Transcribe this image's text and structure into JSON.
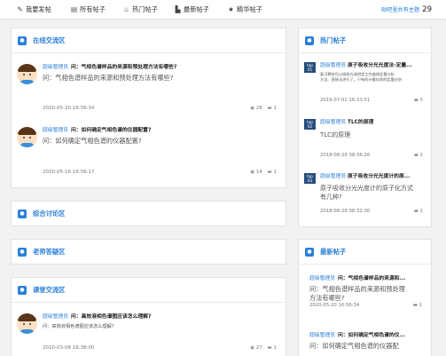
{
  "nav": {
    "items": [
      {
        "icon": "✎",
        "icon_name": "pencil-icon",
        "label": "我要发帖"
      },
      {
        "icon": "▤",
        "icon_name": "list-icon",
        "label": "所有帖子"
      },
      {
        "icon": "♨",
        "icon_name": "flame-icon",
        "label": "热门帖子"
      },
      {
        "icon": "▙",
        "icon_name": "bar-chart-icon",
        "label": "最新帖子"
      },
      {
        "icon": "★",
        "icon_name": "star-icon",
        "label": "精华帖子"
      }
    ],
    "total_label": "贴吧里共有主题",
    "total_count": "29"
  },
  "sections": {
    "online": {
      "title": "在线交流区",
      "posts": [
        {
          "author": "超级管理员",
          "title": "问：气相色谱样品的来源和预处理方法有哪些?",
          "body": "问：气相色谱样品的来源和预处理方法有哪些?",
          "date": "2020-05-20 16:56:34",
          "views": "28",
          "replies": "1"
        },
        {
          "author": "超级管理员",
          "title": "问：如何确定气相色谱的仪器配置?",
          "body": "问：如何确定气相色谱的仪器配置?",
          "date": "2020-05-16 16:56:17",
          "views": "14",
          "replies": "1"
        }
      ]
    },
    "general": {
      "title": "综合讨论区"
    },
    "teacher": {
      "title": "老师答疑区"
    },
    "class": {
      "title": "课堂交流区",
      "posts": [
        {
          "author": "超级管理员",
          "title": "问：高效液相色谱图应该怎么理解?",
          "body": "问：高效液相色谱图应该怎么理解?",
          "date": "2020-03-08 16:38:00",
          "views": "27",
          "replies": "1"
        }
      ]
    }
  },
  "hot": {
    "title": "热门帖子",
    "items": [
      {
        "rank": "01",
        "author": "超级管理员",
        "title": "原子吸收分光光度法-定量...",
        "body_lines": [
          "复习教材可以吸收光谱测定工作曲线定量分析",
          "方法、直接法进行了，只有的计量仪质的定量分析"
        ],
        "date": "2019-07-01 16:33:51",
        "replies": "5"
      },
      {
        "rank": "02",
        "author": "超级管理员",
        "title": "TLC的原理",
        "body_lines": [
          "TLC的原理"
        ],
        "date": "2018-08-28 08:36:26",
        "replies": "1"
      },
      {
        "rank": "03",
        "author": "超级管理员",
        "title": "原子吸收分光光度计的原...",
        "body_lines": [
          "原子吸收分光光度计的原子化方式",
          "有几种?"
        ],
        "date": "2018-08-28 08:32:30",
        "replies": "1"
      }
    ]
  },
  "newest": {
    "title": "最新帖子",
    "items": [
      {
        "author": "超级管理员",
        "title": "问：气相色谱样品的来源和...",
        "body_lines": [
          "问：气相色谱样品的来源和预处理",
          "方法有哪些?"
        ],
        "date": "2020-05-20 16:56:34",
        "replies": "1"
      },
      {
        "author": "超级管理员",
        "title": "问：如何确定气相色谱的仪...",
        "body_lines": [
          "问：如何确定气相色谱的仪器配"
        ]
      }
    ]
  },
  "colors": {
    "accent": "#2a7fd8",
    "badge": "#264e7e"
  }
}
